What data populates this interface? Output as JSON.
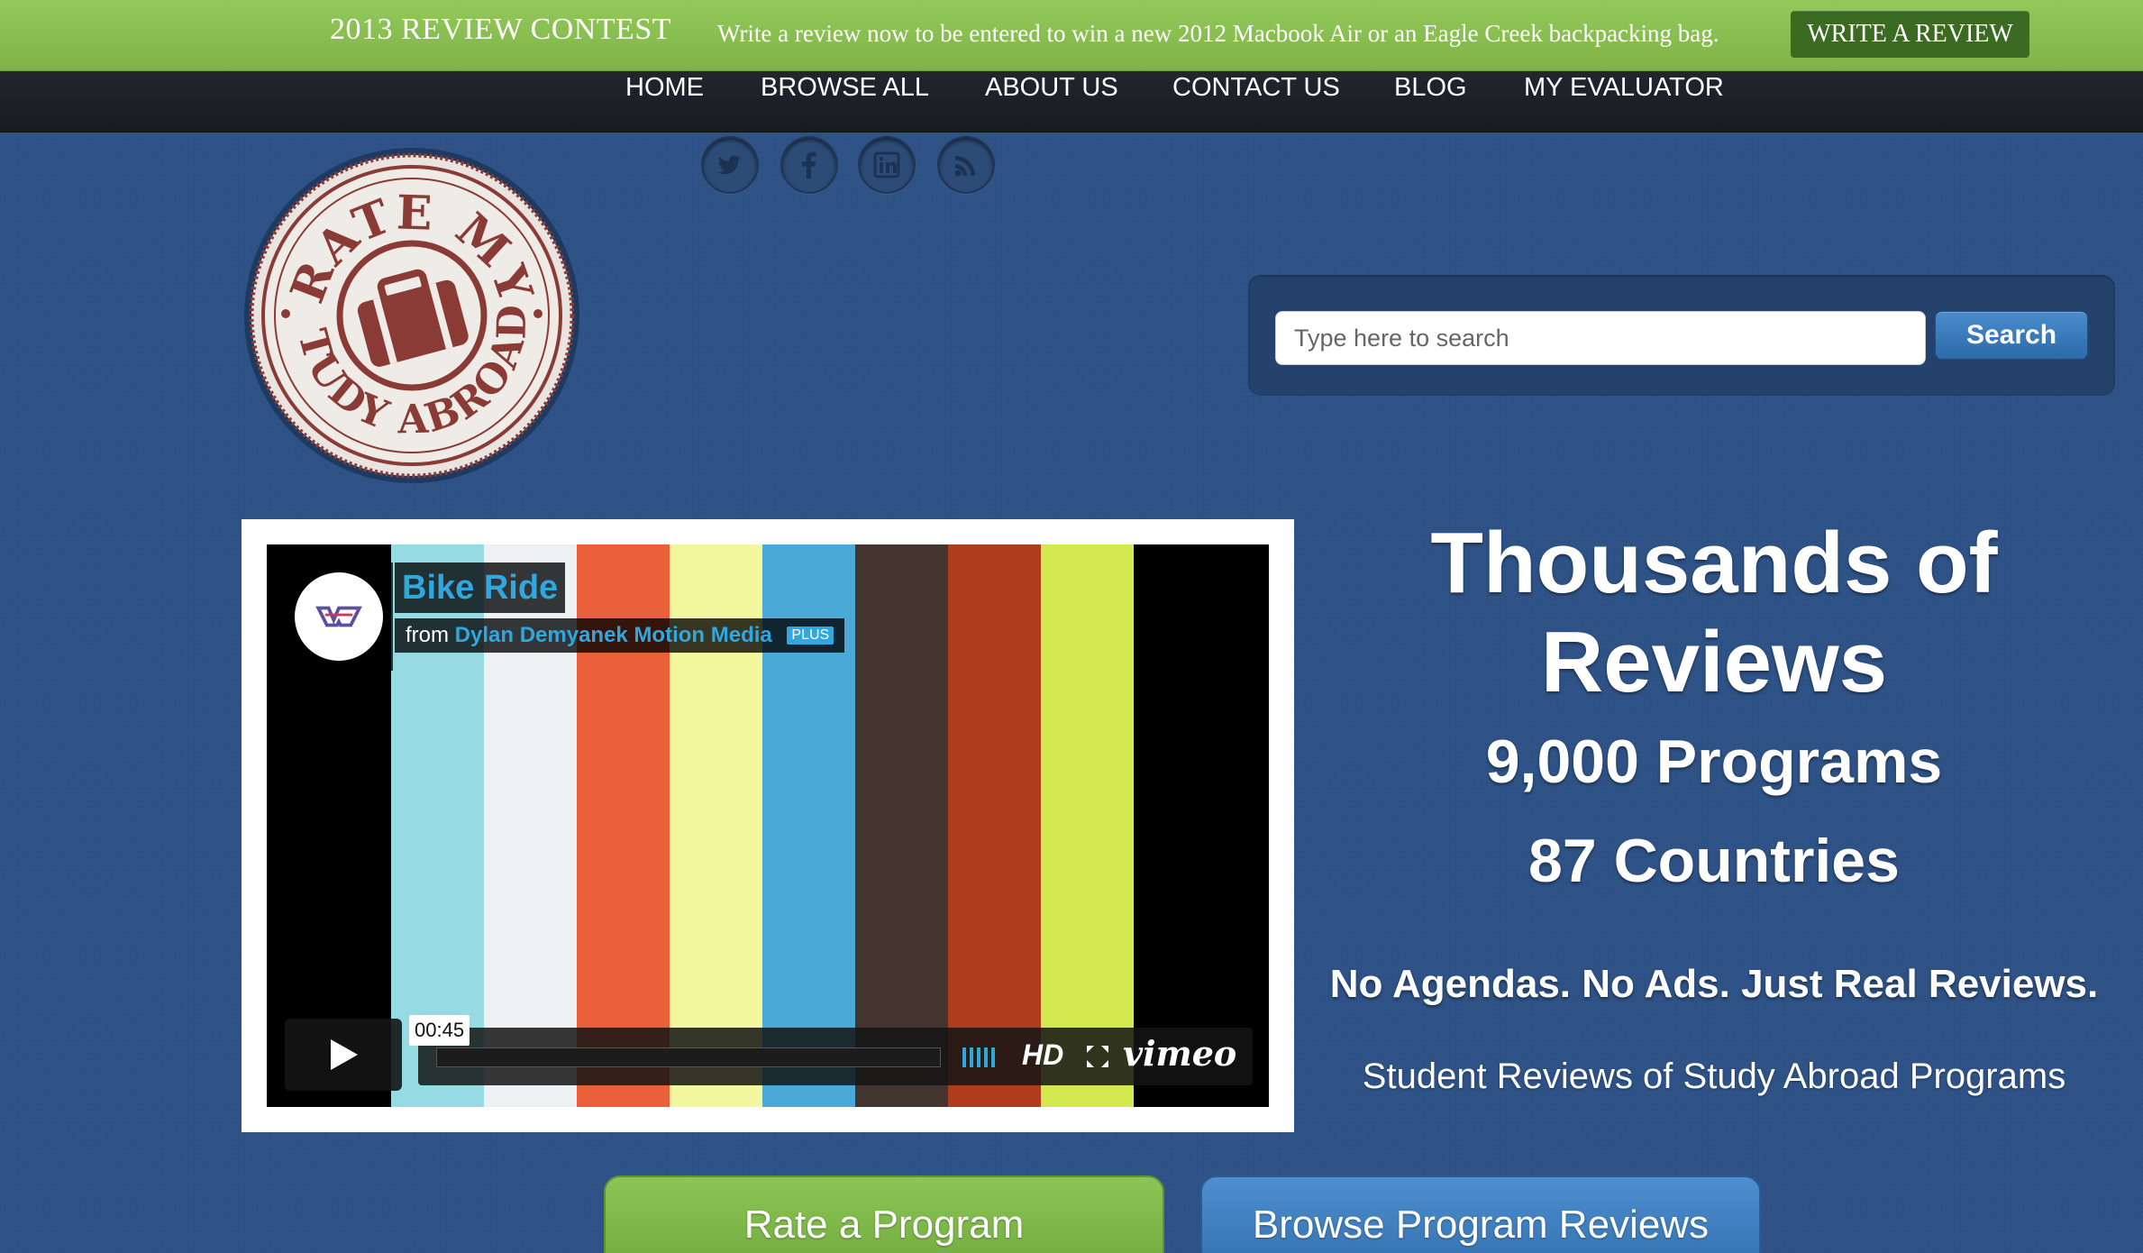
{
  "promo": {
    "title": "2013 REVIEW CONTEST",
    "text": "Write a review now to be entered to win a new 2012 Macbook Air or an Eagle Creek backpacking bag.",
    "button": "WRITE A REVIEW"
  },
  "nav": {
    "items": [
      {
        "label": "HOME"
      },
      {
        "label": "BROWSE ALL"
      },
      {
        "label": "ABOUT US"
      },
      {
        "label": "CONTACT US"
      },
      {
        "label": "BLOG"
      },
      {
        "label": "MY EVALUATOR"
      }
    ]
  },
  "social": [
    "twitter-icon",
    "facebook-icon",
    "linkedin-icon",
    "rss-icon"
  ],
  "logo": {
    "top_text": "RATE MY",
    "bottom_text": "STUDY ABROAD",
    "color": "#8a3b35"
  },
  "search": {
    "placeholder": "Type here to search",
    "button": "Search"
  },
  "video": {
    "title": "Bike Ride",
    "from_label": "from",
    "author": "Dylan Demyanek Motion Media",
    "badge": "PLUS",
    "time": "00:45",
    "hd": "HD",
    "brand": "vimeo",
    "bars": [
      "#000000",
      "#96dae3",
      "#edf1f3",
      "#e9603a",
      "#f3f79d",
      "#4aa9d6",
      "#43342f",
      "#b03c1e",
      "#d4e94f",
      "#000000"
    ]
  },
  "headline": {
    "big": "Thousands of Reviews",
    "programs": "9,000 Programs",
    "countries": "87 Countries",
    "slogan": "No Agendas. No Ads. Just Real Reviews.",
    "tagline": "Student Reviews of Study Abroad Programs"
  },
  "cta": {
    "rate": "Rate a Program",
    "browse": "Browse Program Reviews"
  },
  "colors": {
    "background": "#2e5286",
    "promo_green": "#86bd50",
    "nav_dark": "#1d2026",
    "accent_blue": "#2f6cab"
  }
}
